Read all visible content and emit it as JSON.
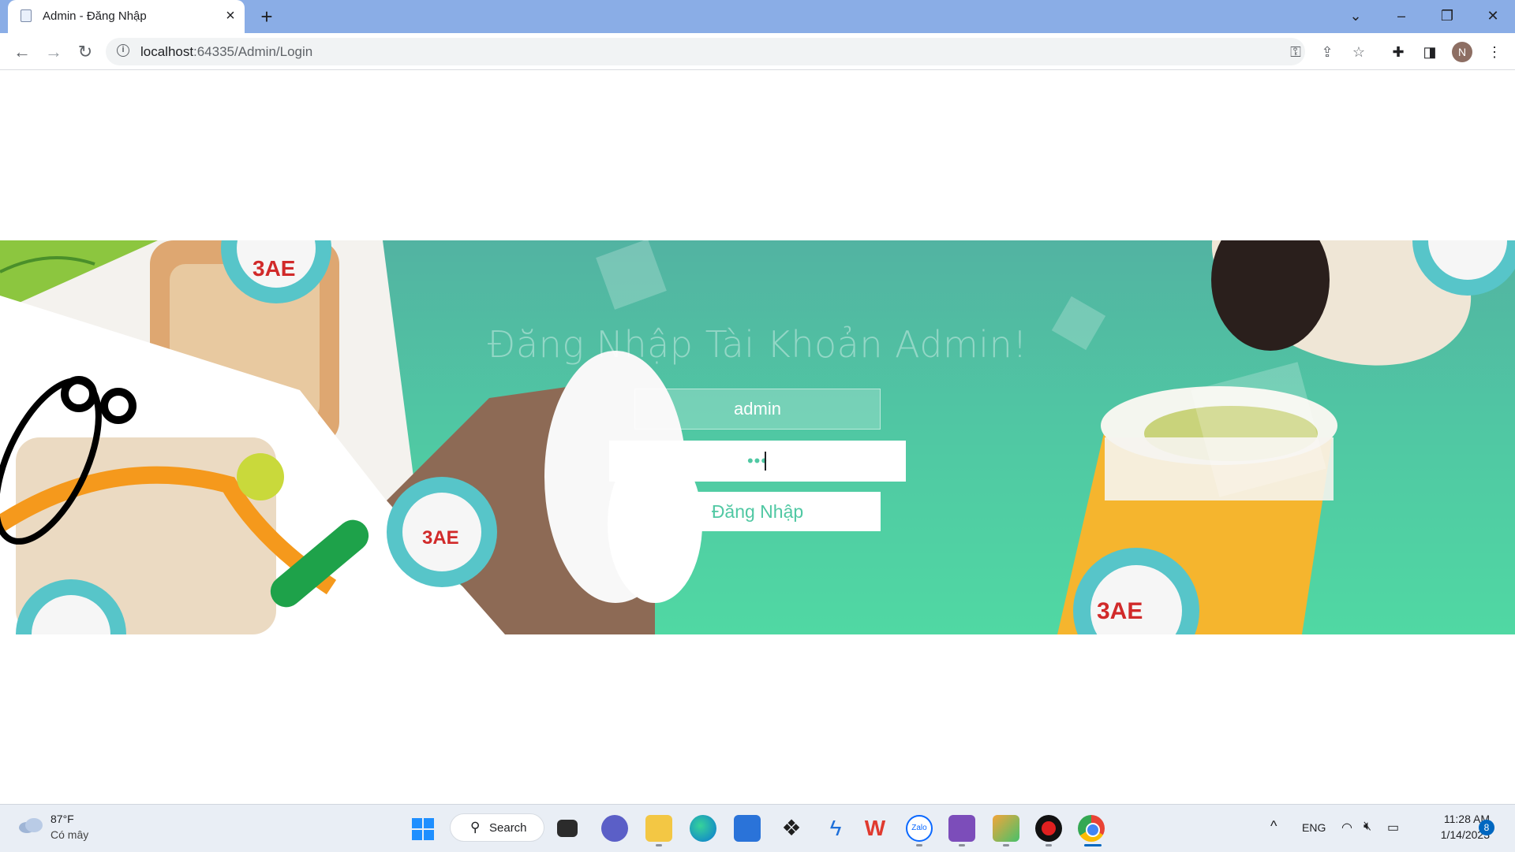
{
  "browser": {
    "tab_title": "Admin - Đăng Nhập",
    "url_host": "localhost",
    "url_rest": ":64335/Admin/Login",
    "profile_initial": "N"
  },
  "page": {
    "heading": "Đăng Nhập Tài Khoản Admin!",
    "username_value": "admin",
    "password_mask": "•••",
    "login_label": "Đăng Nhập"
  },
  "taskbar": {
    "weather_temp": "87°F",
    "weather_desc": "Có mây",
    "search_label": "Search",
    "language": "ENG",
    "time": "11:28 AM",
    "date": "1/14/2023",
    "notification_count": "8",
    "apps": [
      "start-icon",
      "task-view-icon",
      "teams-chat-icon",
      "file-explorer-icon",
      "edge-icon",
      "microsoft-store-icon",
      "dropbox-icon",
      "vscode-icon",
      "wps-office-icon",
      "zalo-icon",
      "visual-studio-icon",
      "snipping-tool-icon",
      "screen-recorder-icon",
      "chrome-icon"
    ]
  },
  "colors": {
    "accent": "#50c8a3",
    "tabstrip": "#8aade6",
    "taskbar": "#e9eef5"
  }
}
